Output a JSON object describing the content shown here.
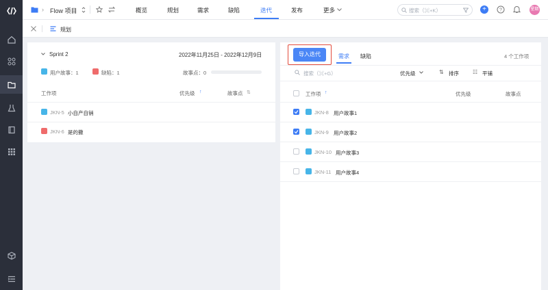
{
  "header": {
    "project_name": "Flow 项目",
    "tabs": [
      "概览",
      "规划",
      "需求",
      "缺陷",
      "迭代",
      "发布",
      "更多"
    ],
    "active_tab": "迭代",
    "search_placeholder": "搜索（⌘+K）",
    "avatar_text": "星期"
  },
  "subheader": {
    "title": "规划"
  },
  "sprint_panel": {
    "sprint_name": "Sprint 2",
    "date_range": "2022年11月25日 - 2022年12月9日",
    "story_count_label": "用户故事：1",
    "bug_count_label": "缺陷：1",
    "points_label": "故事点：0",
    "columns": {
      "item": "工作项",
      "priority": "优先级",
      "points": "故事点"
    },
    "rows": [
      {
        "id": "JKN-5",
        "title": "小自产自销",
        "type": "story"
      },
      {
        "id": "JKN-6",
        "title": "是的撒",
        "type": "bug"
      }
    ]
  },
  "backlog_panel": {
    "import_button": "导入迭代",
    "tabs": [
      "需求",
      "缺陷"
    ],
    "active_tab": "需求",
    "count_label": "4 个工作项",
    "search_placeholder": "搜索（⌘+G）",
    "toolbar": {
      "priority": "优先级",
      "sort": "排序",
      "flat": "平铺"
    },
    "columns": {
      "item": "工作项",
      "priority": "优先级",
      "points": "故事点"
    },
    "rows": [
      {
        "id": "JKN-8",
        "title": "用户故事1",
        "checked": true
      },
      {
        "id": "JKN-9",
        "title": "用户故事2",
        "checked": true
      },
      {
        "id": "JKN-10",
        "title": "用户故事3",
        "checked": false
      },
      {
        "id": "JKN-11",
        "title": "用户故事4",
        "checked": false
      }
    ]
  },
  "colors": {
    "accent": "#3d7cf5",
    "rail": "#2b2f3a",
    "story": "#47b5e8",
    "bug": "#ef6b6b",
    "highlight": "#e24a3b"
  }
}
